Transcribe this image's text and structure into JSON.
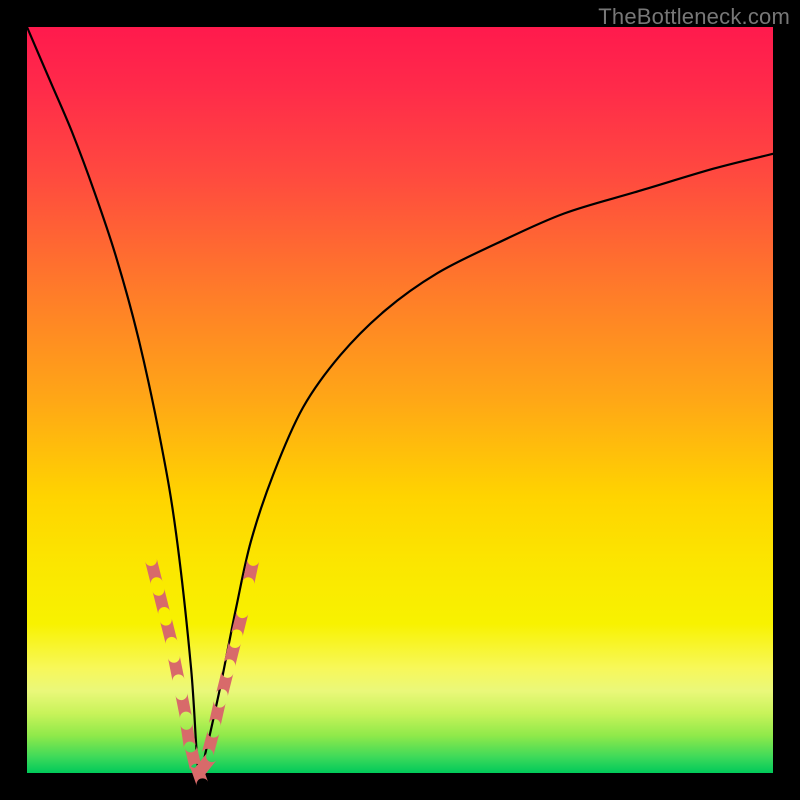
{
  "watermark": "TheBottleneck.com",
  "colors": {
    "frame": "#000000",
    "gradient_top": "#ff1a4d",
    "gradient_mid": "#ffd400",
    "gradient_bottom": "#00c95a",
    "curve": "#000000",
    "markers": "#d86a6a"
  },
  "chart_data": {
    "type": "line",
    "title": "",
    "xlabel": "",
    "ylabel": "",
    "xlim": [
      0,
      100
    ],
    "ylim": [
      0,
      100
    ],
    "grid": false,
    "legend": false,
    "note": "V-shaped bottleneck valley; y≈100 at x≈0, y≈0 at x≈23, y rises toward right.",
    "series": [
      {
        "name": "bottleneck-curve",
        "x": [
          0,
          3,
          6,
          9,
          12,
          15,
          18,
          20,
          22,
          23,
          24,
          26,
          28,
          30,
          33,
          37,
          42,
          48,
          55,
          63,
          72,
          82,
          92,
          100
        ],
        "y": [
          100,
          93,
          86,
          78,
          69,
          58,
          44,
          32,
          14,
          0,
          3,
          12,
          22,
          31,
          40,
          49,
          56,
          62,
          67,
          71,
          75,
          78,
          81,
          83
        ]
      }
    ],
    "markers": {
      "name": "highlighted-points",
      "color": "#d86a6a",
      "x": [
        17,
        18,
        19,
        20,
        21,
        21.6,
        22.3,
        23,
        23.8,
        24.6,
        25.5,
        26.5,
        27.5,
        28.5,
        30
      ],
      "y": [
        27,
        23,
        19,
        14,
        9,
        5,
        2,
        0,
        1,
        4,
        8,
        12,
        16,
        20,
        27
      ]
    }
  }
}
